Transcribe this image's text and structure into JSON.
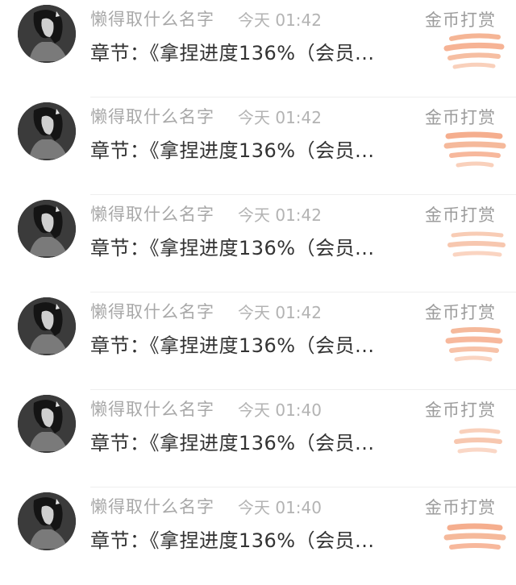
{
  "comments": [
    {
      "username": "懒得取什么名字",
      "time": "今天 01:42",
      "message": "章节：《拿捏进度136%（会员...",
      "action": "金币打赏"
    },
    {
      "username": "懒得取什么名字",
      "time": "今天 01:42",
      "message": "章节：《拿捏进度136%（会员...",
      "action": "金币打赏"
    },
    {
      "username": "懒得取什么名字",
      "time": "今天 01:42",
      "message": "章节：《拿捏进度136%（会员...",
      "action": "金币打赏"
    },
    {
      "username": "懒得取什么名字",
      "time": "今天 01:42",
      "message": "章节：《拿捏进度136%（会员...",
      "action": "金币打赏"
    },
    {
      "username": "懒得取什么名字",
      "time": "今天 01:40",
      "message": "章节：《拿捏进度136%（会员...",
      "action": "金币打赏"
    },
    {
      "username": "懒得取什么名字",
      "time": "今天 01:40",
      "message": "章节：《拿捏进度136%（会员...",
      "action": "金币打赏"
    }
  ],
  "icons": {
    "avatar": "avatar-icon",
    "reward": "gift-sticker-icon"
  },
  "colors": {
    "username": "#a8a8a8",
    "time": "#b3b3b3",
    "message": "#333333",
    "action": "#9c9c9c",
    "sticker": "#f2a27a"
  }
}
